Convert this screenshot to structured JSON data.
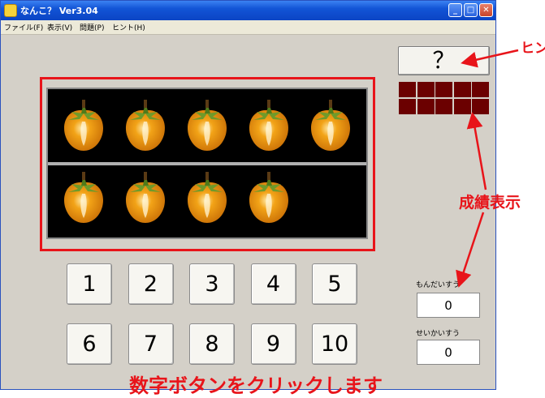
{
  "window": {
    "title": "なんこ？ Ver3.04",
    "controls": {
      "minimize": "_",
      "maximize": "□",
      "close": "✕"
    }
  },
  "menu": {
    "items": [
      {
        "label": "ファイル(F)"
      },
      {
        "label": "表示(V)"
      },
      {
        "label": "問題(P)"
      },
      {
        "label": "ヒント(H)"
      }
    ]
  },
  "display": {
    "icon": "persimmon-icon",
    "top_row_count": 5,
    "bottom_row_count": 4
  },
  "hint_button": {
    "label": "？"
  },
  "score_grid": {
    "rows": 2,
    "columns": 5,
    "color": "#6b0000"
  },
  "number_buttons": [
    "1",
    "2",
    "3",
    "4",
    "5",
    "6",
    "7",
    "8",
    "9",
    "10"
  ],
  "stats": {
    "problem_count_label": "もんだいすう",
    "problem_count": "0",
    "correct_count_label": "せいかいすう",
    "correct_count": "0"
  },
  "annotations": {
    "hint": "ヒント",
    "score_display": "成績表示",
    "number_buttons": "数字ボタンをクリックします",
    "color": "#e8141a"
  },
  "colors": {
    "titlebar": "#0b44c4",
    "window_bg": "#d4d0c8",
    "persimmon": "#f2a317",
    "leaf": "#6f9a2a"
  }
}
